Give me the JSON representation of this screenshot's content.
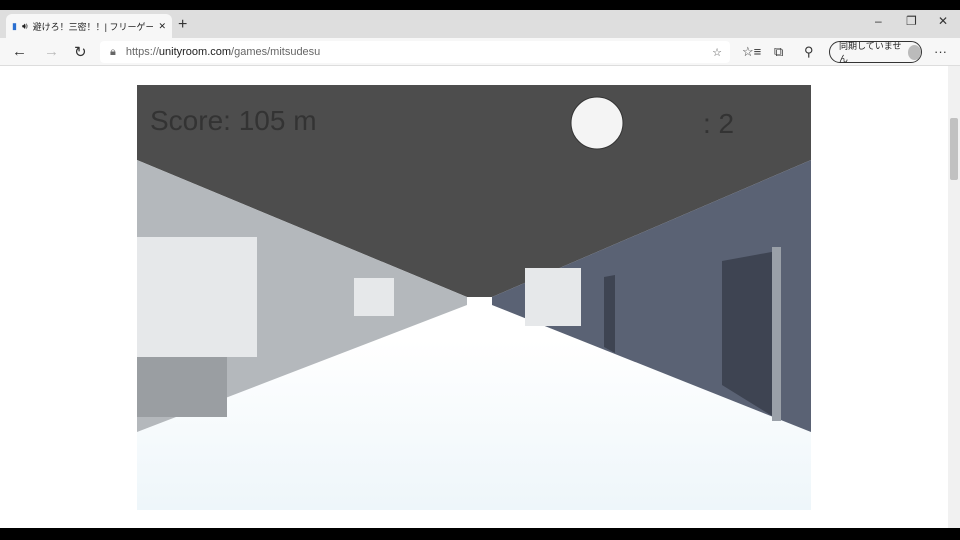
{
  "browser": {
    "tab_title": "避けろ！三密！！| フリーゲーム",
    "url_prefix": "https://",
    "url_domain": "unityroom.com",
    "url_path": "/games/mitsudesu",
    "sync_label": "同期していません"
  },
  "game": {
    "score_text": "Score: 105 m",
    "mask_count_text": ": 2"
  },
  "colors": {
    "ceiling": "#4d4d4d",
    "left_wall": "#b4b8bc",
    "right_wall": "#5a6274",
    "floor": "#ffffff"
  }
}
